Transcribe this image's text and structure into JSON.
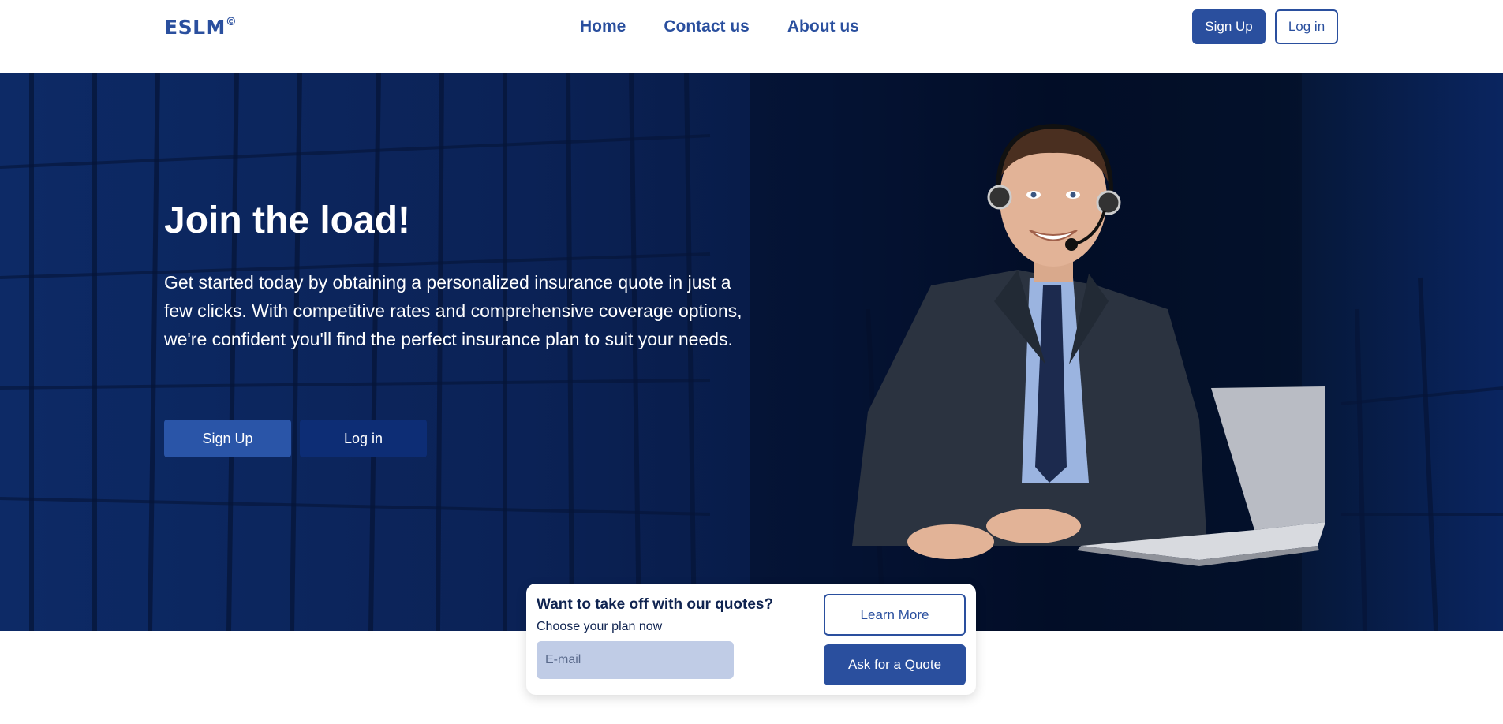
{
  "header": {
    "logo_text": "ESLM",
    "logo_mark": "©",
    "nav": [
      {
        "label": "Home"
      },
      {
        "label": "Contact us"
      },
      {
        "label": "About us"
      }
    ],
    "signup_label": "Sign Up",
    "login_label": "Log in"
  },
  "hero": {
    "title": "Join the load!",
    "description": "Get started today by obtaining a personalized insurance quote in just a few clicks. With competitive rates and comprehensive coverage options, we're confident you'll find the perfect insurance plan to suit your needs.",
    "signup_label": "Sign Up",
    "login_label": "Log in",
    "image": "agent-with-headset-and-laptop"
  },
  "quote": {
    "title": "Want to take off with our quotes?",
    "subtitle": "Choose your plan now",
    "email_placeholder": "E-mail",
    "learn_more_label": "Learn More",
    "ask_quote_label": "Ask for a Quote"
  },
  "colors": {
    "brand": "#2a4f9e",
    "hero_dark": "#03102e",
    "input_bg": "#c0cce6"
  }
}
